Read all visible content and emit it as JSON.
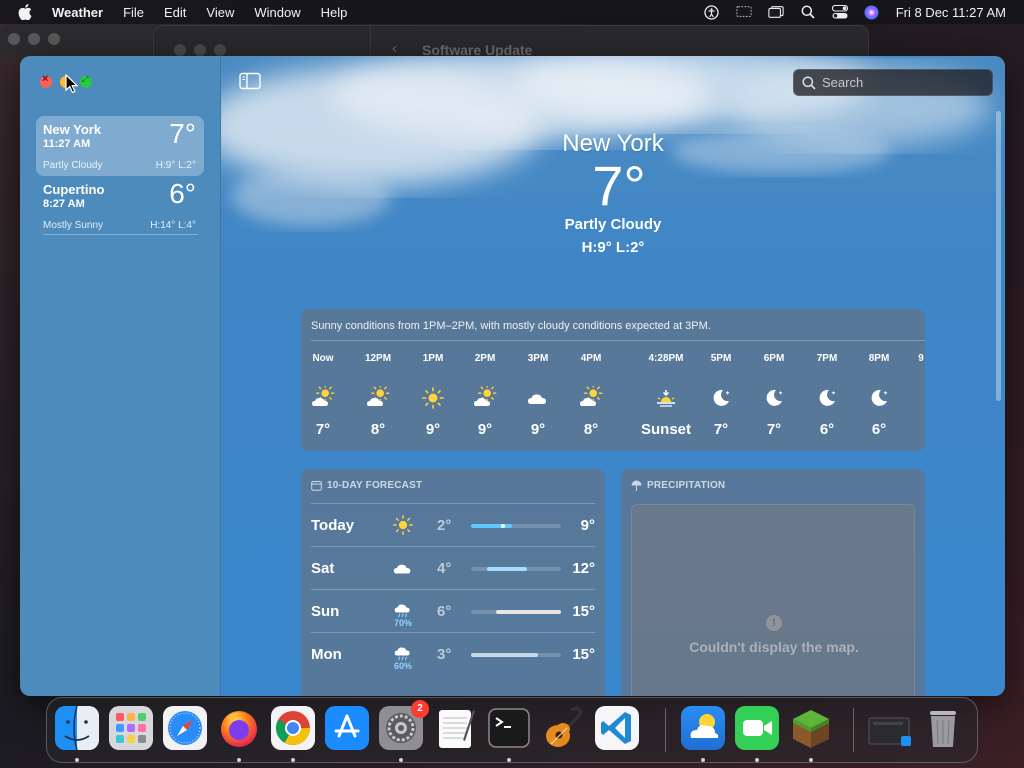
{
  "menubar": {
    "app_name": "Weather",
    "items": [
      "File",
      "Edit",
      "View",
      "Window",
      "Help"
    ],
    "datetime": "Fri 8 Dec  11:27 AM"
  },
  "background_window": {
    "title": "Software Update"
  },
  "sidebar": {
    "locations": [
      {
        "name": "New York",
        "time": "11:27 AM",
        "temp": "7°",
        "condition": "Partly Cloudy",
        "hilo": "H:9°  L:2°",
        "selected": true
      },
      {
        "name": "Cupertino",
        "time": "8:27 AM",
        "temp": "6°",
        "condition": "Mostly Sunny",
        "hilo": "H:14°  L:4°",
        "selected": false
      }
    ]
  },
  "search": {
    "placeholder": "Search"
  },
  "current": {
    "city": "New York",
    "temp": "7°",
    "condition": "Partly Cloudy",
    "hilo": "H:9°  L:2°"
  },
  "hourly": {
    "summary": "Sunny conditions from 1PM–2PM, with mostly cloudy conditions expected at 3PM.",
    "hours": [
      {
        "label": "Now",
        "icon": "partly-cloudy-sun-icon",
        "value": "7°"
      },
      {
        "label": "12PM",
        "icon": "partly-cloudy-sun-icon",
        "value": "8°"
      },
      {
        "label": "1PM",
        "icon": "sun-icon",
        "value": "9°"
      },
      {
        "label": "2PM",
        "icon": "partly-cloudy-sun-icon",
        "value": "9°"
      },
      {
        "label": "3PM",
        "icon": "cloud-icon",
        "value": "9°"
      },
      {
        "label": "4PM",
        "icon": "partly-cloudy-sun-icon",
        "value": "8°"
      },
      {
        "label": "4:28PM",
        "icon": "sunset-icon",
        "value": "Sunset"
      },
      {
        "label": "5PM",
        "icon": "moon-icon",
        "value": "7°"
      },
      {
        "label": "6PM",
        "icon": "moon-icon",
        "value": "7°"
      },
      {
        "label": "7PM",
        "icon": "moon-icon",
        "value": "6°"
      },
      {
        "label": "8PM",
        "icon": "moon-icon",
        "value": "6°"
      }
    ]
  },
  "forecast": {
    "header": "10-DAY FORECAST",
    "days": [
      {
        "day": "Today",
        "icon": "sun-icon",
        "precip": "",
        "lo": "2°",
        "hi": "9°"
      },
      {
        "day": "Sat",
        "icon": "cloud-icon",
        "precip": "",
        "lo": "4°",
        "hi": "12°"
      },
      {
        "day": "Sun",
        "icon": "rain-cloud-icon",
        "precip": "70%",
        "lo": "6°",
        "hi": "15°"
      },
      {
        "day": "Mon",
        "icon": "rain-cloud-icon",
        "precip": "60%",
        "lo": "3°",
        "hi": "15°"
      }
    ]
  },
  "precipitation": {
    "header": "PRECIPITATION",
    "message": "Couldn't display the map."
  },
  "dock": {
    "apps": [
      "Finder",
      "Launchpad",
      "Safari",
      "Firefox",
      "Chrome",
      "App Store",
      "System Settings",
      "TextEdit",
      "Terminal",
      "GarageBand",
      "Visual Studio Code",
      "Weather",
      "FaceTime",
      "Minecraft",
      "Downloads",
      "Trash"
    ],
    "settings_badge": "2"
  }
}
